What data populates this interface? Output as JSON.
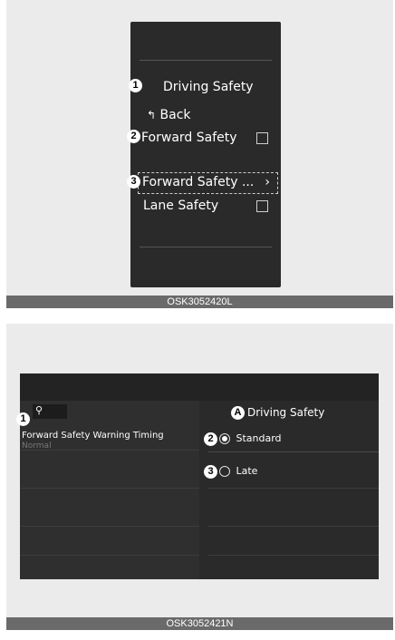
{
  "top_figure": {
    "caption": "OSK3052420L",
    "title": "Driving Safety",
    "back_label": "Back",
    "items": [
      {
        "label": "Forward Safety"
      },
      {
        "label": "Forward Safety ..."
      },
      {
        "label": "Lane Safety"
      }
    ],
    "callouts": [
      "1",
      "2",
      "3"
    ]
  },
  "bottom_figure": {
    "caption": "OSK3052421N",
    "header": "Driving Safety",
    "setting_label": "Forward Safety Warning Timing",
    "setting_value": "Normal",
    "options": [
      {
        "label": "Standard",
        "selected": true
      },
      {
        "label": "Late",
        "selected": false
      }
    ],
    "callouts": [
      "1",
      "2",
      "3",
      "A"
    ]
  }
}
